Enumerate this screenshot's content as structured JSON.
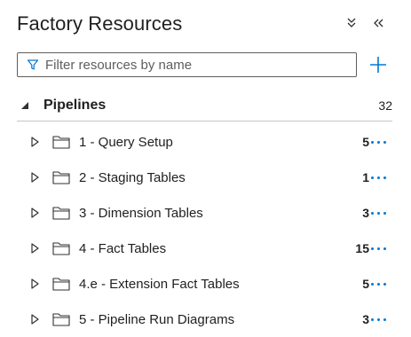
{
  "panel": {
    "title": "Factory Resources",
    "collapse_all_icon": "double-chevron-down-icon",
    "collapse_panel_icon": "double-chevron-left-icon",
    "accent_color": "#0078d4"
  },
  "search": {
    "placeholder": "Filter resources by name",
    "value": "",
    "icon": "filter-icon"
  },
  "add_button": {
    "icon": "plus-icon"
  },
  "section": {
    "label": "Pipelines",
    "count": "32",
    "expanded": true
  },
  "items": [
    {
      "name": "1 - Query Setup",
      "count": "5"
    },
    {
      "name": "2 - Staging Tables",
      "count": "1"
    },
    {
      "name": "3 - Dimension Tables",
      "count": "3"
    },
    {
      "name": "4 - Fact Tables",
      "count": "15"
    },
    {
      "name": "4.e - Extension Fact Tables",
      "count": "5"
    },
    {
      "name": "5 - Pipeline Run Diagrams",
      "count": "3"
    }
  ]
}
